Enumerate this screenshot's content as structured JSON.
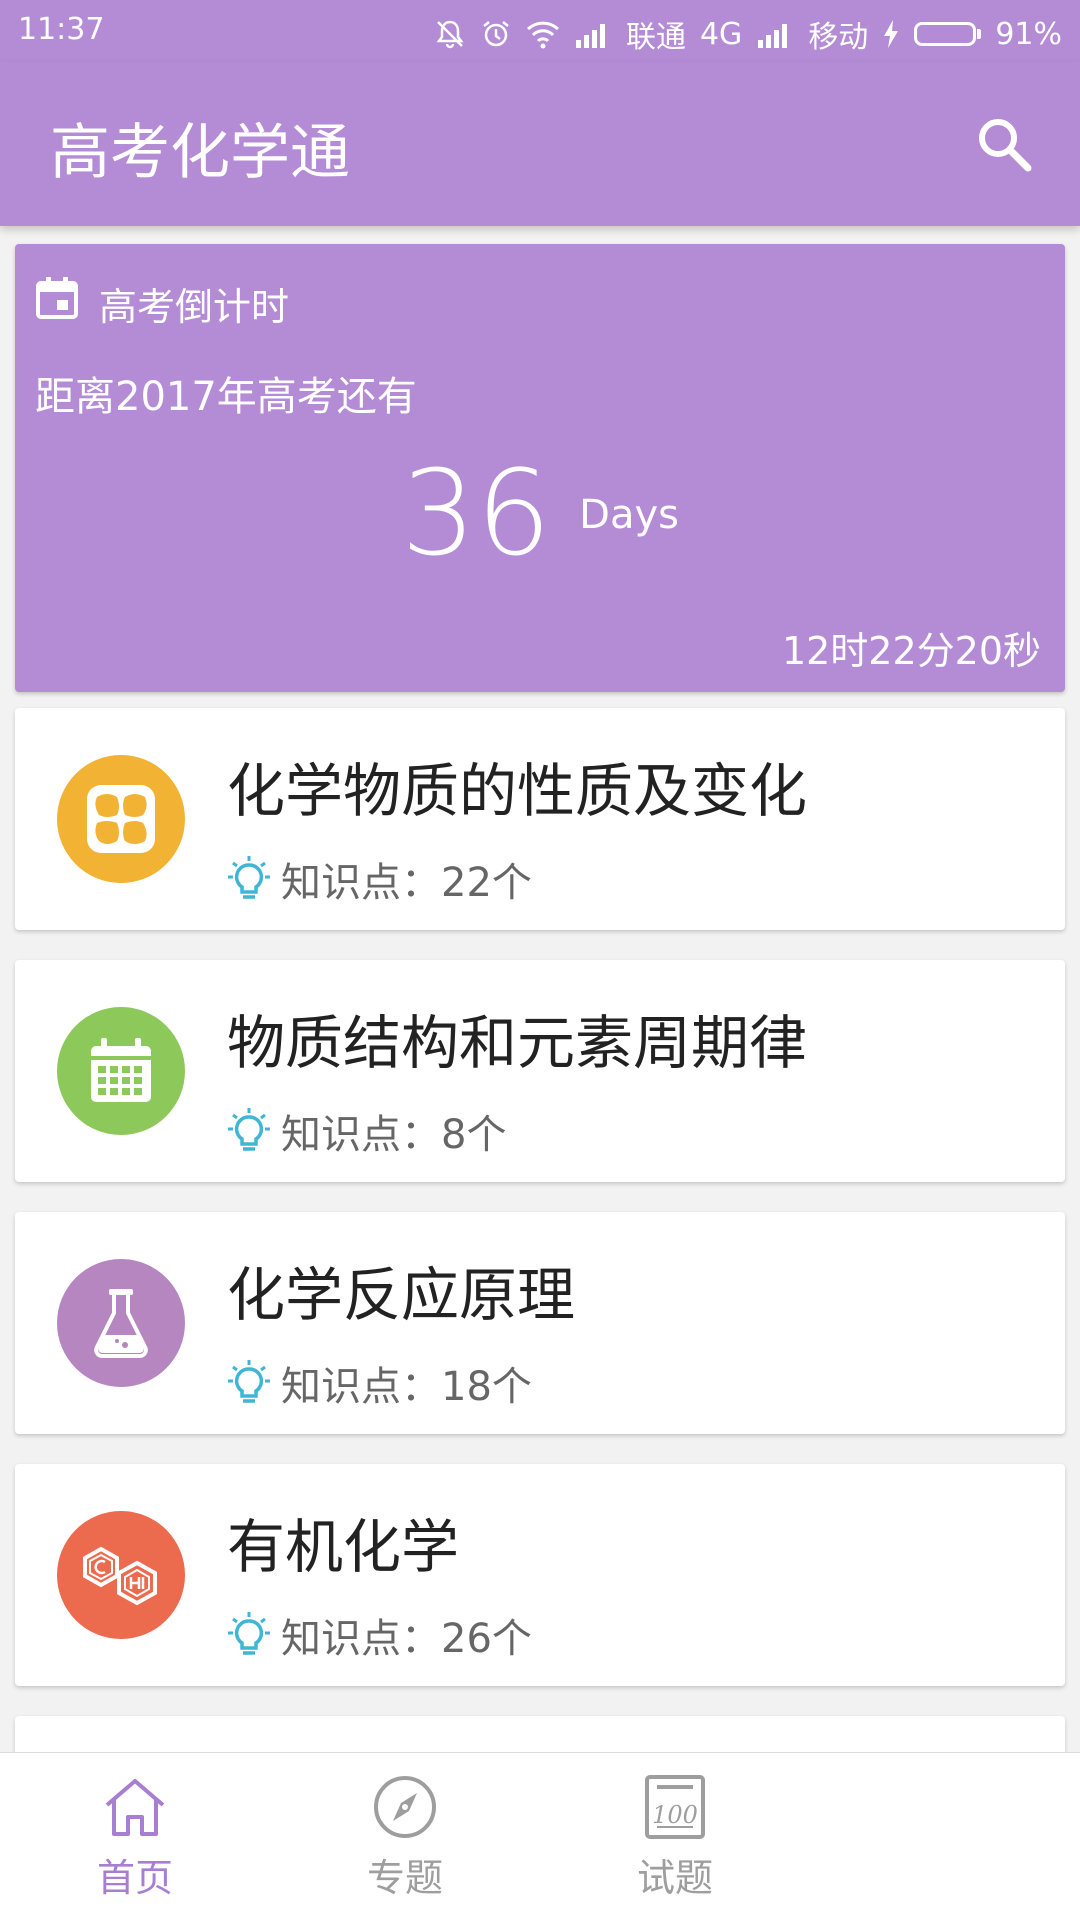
{
  "status_bar": {
    "time": "11:37",
    "carrier1": "联通",
    "network": "4G",
    "carrier2": "移动",
    "battery": "91%",
    "battery_level": 0.91,
    "icons": [
      "mute-icon",
      "alarm-icon",
      "wifi-icon",
      "signal-icon",
      "signal-icon",
      "charging-icon",
      "battery-icon"
    ]
  },
  "app_bar": {
    "title": "高考化学通",
    "search_icon": "search-icon"
  },
  "countdown": {
    "label": "高考倒计时",
    "subtitle": "距离2017年高考还有",
    "days": "36",
    "days_unit": "Days",
    "remaining_time": "12时22分20秒",
    "icon": "calendar-icon"
  },
  "topics": [
    {
      "name": "化学物质的性质及变化",
      "meta": "知识点：22个",
      "color": "#f2b233",
      "icon": "grid-icon"
    },
    {
      "name": "物质结构和元素周期律",
      "meta": "知识点：8个",
      "color": "#8dc85a",
      "icon": "calendar-grid-icon"
    },
    {
      "name": "化学反应原理",
      "meta": "知识点：18个",
      "color": "#b586c0",
      "icon": "flask-icon"
    },
    {
      "name": "有机化学",
      "meta": "知识点：26个",
      "color": "#ec6a4d",
      "icon": "benzene-icon"
    }
  ],
  "colors": {
    "primary": "#b48cd6",
    "bulb": "#3fb6d6",
    "nav_active": "#a87ed3",
    "nav_inactive": "#9e9e9e"
  },
  "bottom_nav": [
    {
      "label": "首页",
      "icon": "home-icon",
      "active": true
    },
    {
      "label": "专题",
      "icon": "compass-icon",
      "active": false
    },
    {
      "label": "试题",
      "icon": "exam-icon",
      "active": false
    }
  ]
}
